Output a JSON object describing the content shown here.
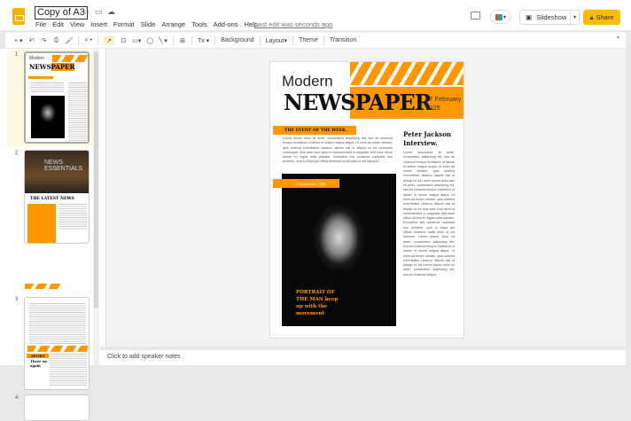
{
  "header": {
    "title": "Copy of A3",
    "menu": [
      "File",
      "Edit",
      "View",
      "Insert",
      "Format",
      "Slide",
      "Arrange",
      "Tools",
      "Add-ons",
      "Help"
    ],
    "last_edit": "Last edit was seconds ago",
    "slideshow": "Slideshow",
    "share": "Share"
  },
  "toolbar": {
    "background": "Background",
    "layout": "Layout",
    "theme": "Theme",
    "transition": "Transition"
  },
  "filmstrip": {
    "numbers": [
      "1",
      "2",
      "3",
      "4"
    ],
    "thumb2_title": "THE LATEST NEWS",
    "thumb2_photo": "NEWS ESSENTIALS",
    "thumb3_label": "SPORT",
    "thumb3_title": "Three on again"
  },
  "slide": {
    "modern": "Modern",
    "news": "NEWS",
    "paper": "PAPER",
    "date": "17 February 2025",
    "event_label": "THE EVENT OF THE WEEK.",
    "event_text": "Lorem ipsum dolor sit amet, consectetur adipiscing elit, sed do eiusmod tempor incididunt ut labore et dolore magna aliqua. Ut enim ad minim veniam, quis nostrud exercitation ullamco laboris nisi ut aliquip ex ea commodo consequat. Duis aute irure dolor in reprehenderit in voluptate velit esse cillum dolore eu fugiat nulla pariatur. Excepteur sint occaecat cupidatat non proident, sunt in culpa qui officia deserunt mollit anim id est laborum.\"",
    "photo_date": "17 september, 2011",
    "portrait_caption": "PORTRAIT OF THE MAN keep up with the movement",
    "interview_title": "Peter Jackson Interview.",
    "interview_text": "Lorem ipsumdolor sit amet, consectetur adipiscing elit, sed do eiusmod tempor incididunt ut labore et dolore magna aliqua. Ut enim ad minim veniam, quis nostrud exercitation ullamco laboris nisi ut aliquip ex ea Lorem ipsum dolor ade sit amet, consectetur adipiscing elit, sed do eiusmod tempor incididunt ut labore et dolore magna aliqua. Ut enim ad minim veniam, quis nostrud exercitation ullamco laboris nisi ut aliquip ex ea duis aute irure dolor in reprehenderit in voluptate velit esse cillum dolore eu fugiat nulla pariatur. Excepteur sint occaecat cupidatat non proident, sunt in culpa qui officia deserunt mollit anim id est laborum. Lorem ipsum dolor sit amet, consectetur adipiscing elit, sed do eiusmod tempor incididunt ut labore et dolore magna aliqua. Ut enim ad minim veniam, quis nostrud exercitation ullamco laboris nisi ut aliquip ex ea Lorem ipsum dolor sit amet, consectetur adipiscing elit, sed do eiusmod tempor"
  },
  "notes": {
    "placeholder": "Click to add speaker notes"
  },
  "colors": {
    "accent": "#ff9800",
    "share": "#fbbc04"
  }
}
